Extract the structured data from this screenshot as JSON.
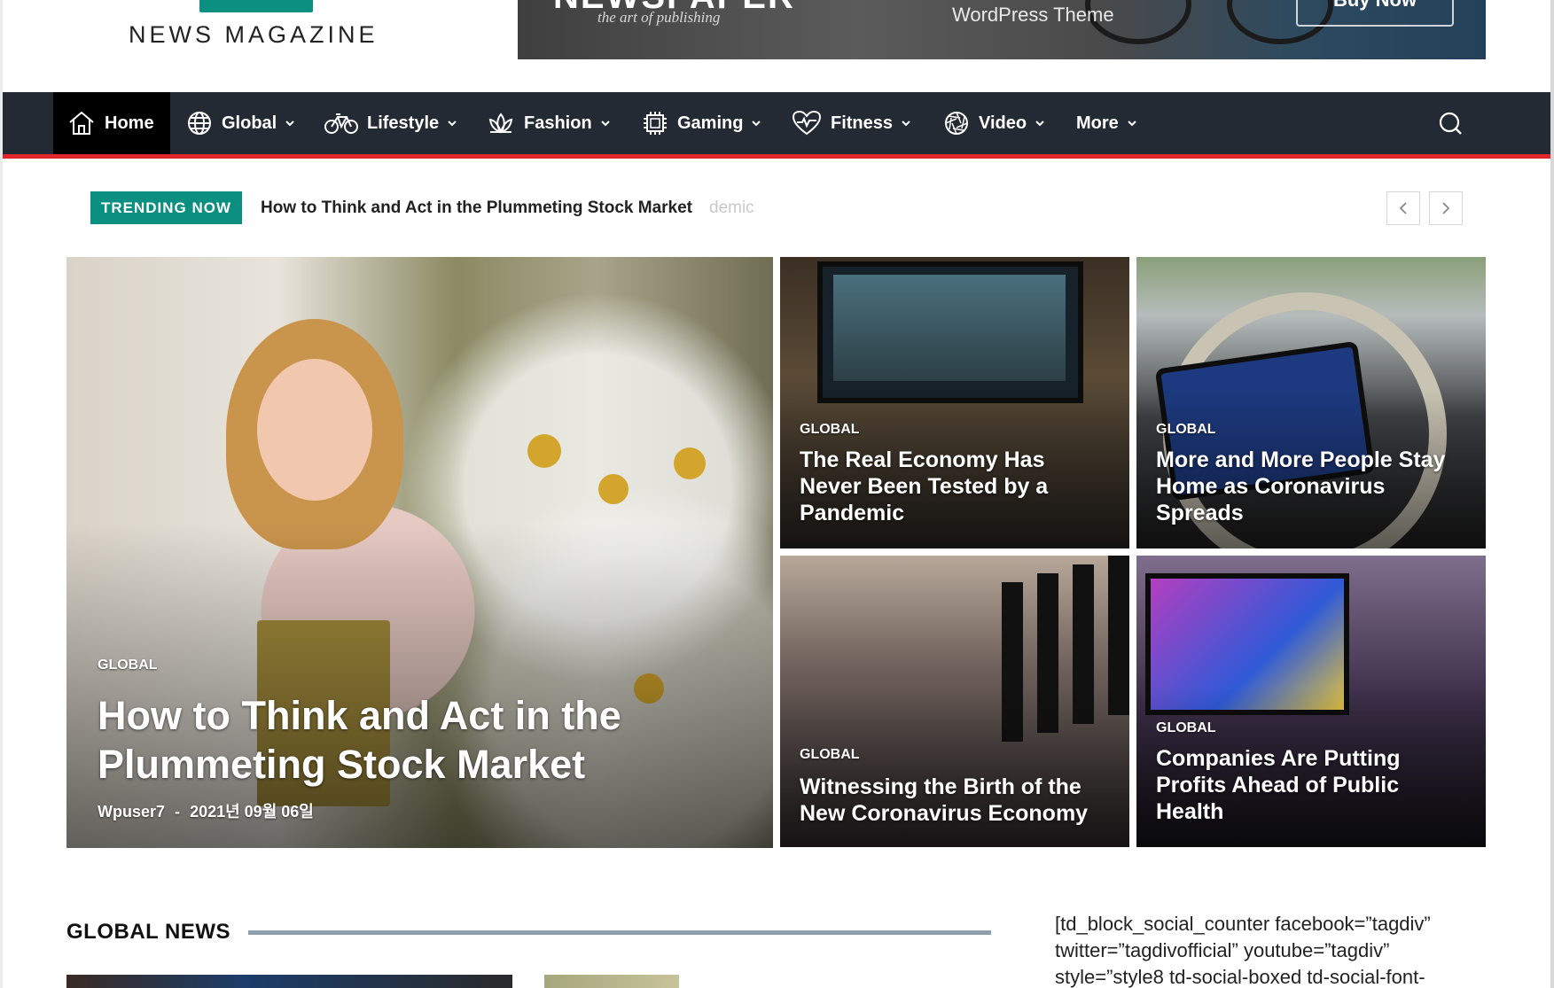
{
  "header": {
    "logo_text": "NEWS MAGAZINE",
    "banner": {
      "title": "NEWSPAPER",
      "tagline": "the art of publishing",
      "theme": "WordPress Theme",
      "button_label": "Buy Now"
    }
  },
  "nav": {
    "items": [
      {
        "label": "Home",
        "icon": "home-icon"
      },
      {
        "label": "Global",
        "icon": "globe-icon"
      },
      {
        "label": "Lifestyle",
        "icon": "bicycle-icon"
      },
      {
        "label": "Fashion",
        "icon": "lotus-icon"
      },
      {
        "label": "Gaming",
        "icon": "chip-icon"
      },
      {
        "label": "Fitness",
        "icon": "heartbeat-icon"
      },
      {
        "label": "Video",
        "icon": "aperture-icon"
      },
      {
        "label": "More",
        "icon": ""
      }
    ],
    "search_icon": "search-icon",
    "accent_color": "#e2262b",
    "background_color": "#232a33"
  },
  "trending": {
    "badge": "TRENDING NOW",
    "headline": "How to Think and Act in the Plummeting Stock Market",
    "faded_tail": "demic",
    "badge_color": "#0b8f80"
  },
  "featured": {
    "main": {
      "category": "GLOBAL",
      "title_line1": "How to Think and Act in the",
      "title_line2": "Plummeting Stock Market",
      "author": "Wpuser7",
      "separator": "-",
      "date": "2021년 09월 06일"
    },
    "cards": [
      {
        "category": "GLOBAL",
        "title_lines": [
          "The Real Economy Has",
          "Never Been Tested by a",
          "Pandemic"
        ]
      },
      {
        "category": "GLOBAL",
        "title_lines": [
          "More and More People Stay",
          "Home as Coronavirus",
          "Spreads"
        ]
      },
      {
        "category": "GLOBAL",
        "title_lines": [
          "Witnessing the Birth of the",
          "New Coronavirus Economy"
        ]
      },
      {
        "category": "GLOBAL",
        "title_lines": [
          "Companies Are Putting",
          "Profits Ahead of Public",
          "Health"
        ]
      }
    ]
  },
  "global_news": {
    "title": "GLOBAL NEWS"
  },
  "sidebar": {
    "shortcode_lines": [
      "[td_block_social_counter facebook=”tagdiv”",
      "twitter=”tagdivofficial” youtube=”tagdiv”",
      "style=”style8 td-social-boxed td-social-font-"
    ]
  }
}
